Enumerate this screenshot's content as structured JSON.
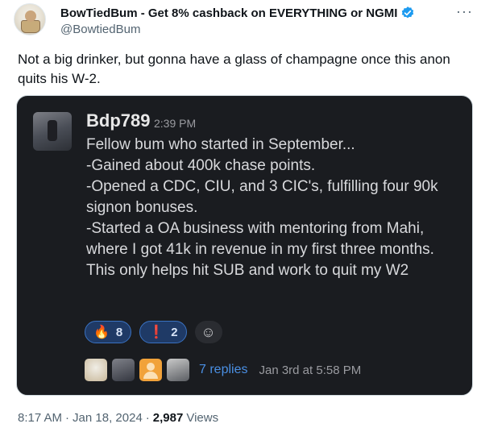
{
  "author": {
    "display_name": "BowTiedBum - Get 8% cashback on EVERYTHING or NGMI",
    "handle": "@BowtiedBum",
    "verified_icon": "verified-badge-icon"
  },
  "tweet": {
    "text": "Not a big drinker, but gonna have a glass of champagne once this anon quits his W-2."
  },
  "embedded_slack": {
    "author": "Bdp789",
    "time": "2:39 PM",
    "message": "Fellow bum who started in September...\n-Gained about 400k chase points.\n-Opened a CDC, CIU, and 3 CIC's, fulfilling four 90k signon bonuses.\n-Started a OA business with mentoring from Mahi, where I got 41k in revenue in my first three months. This only helps hit SUB and work to quit my W2",
    "reactions": [
      {
        "emoji": "🔥",
        "count": "8"
      },
      {
        "emoji": "❗",
        "count": "2"
      }
    ],
    "thread": {
      "replies": "7 replies",
      "last_reply": "Jan 3rd at 5:58 PM"
    }
  },
  "meta": {
    "time": "8:17 AM",
    "date": "Jan 18, 2024",
    "separator": "·",
    "views_count": "2,987",
    "views_label": "Views"
  },
  "colors": {
    "slack_bg": "#1a1c20",
    "reaction_bg": "#1f3a66",
    "link_blue": "#4a8fe3",
    "verified_blue": "#1d9bf0"
  }
}
